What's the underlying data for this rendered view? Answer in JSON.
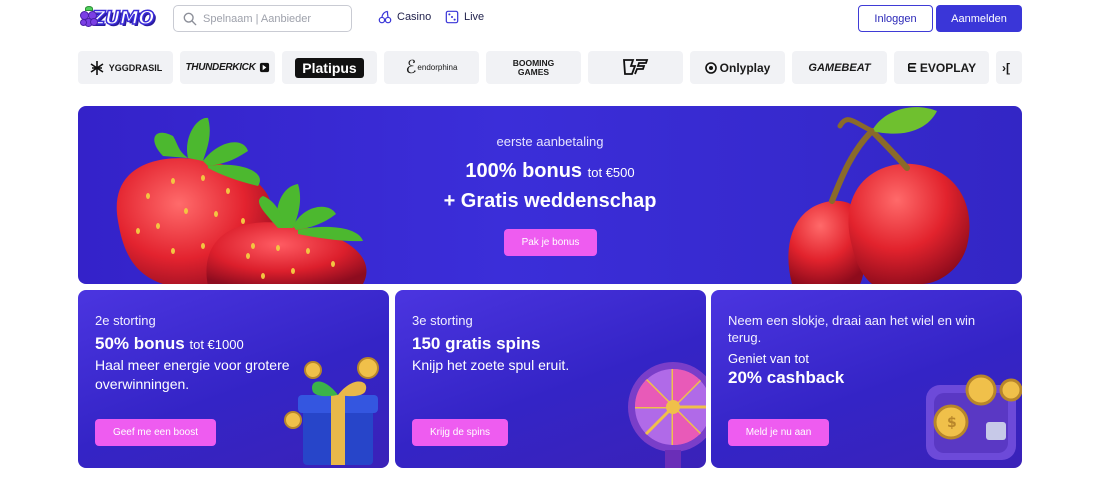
{
  "header": {
    "logo_text": "ZUMO",
    "search_placeholder": "Spelnaam | Aanbieder",
    "nav": [
      {
        "label": "Casino",
        "icon": "cherries-icon"
      },
      {
        "label": "Live",
        "icon": "dice-icon"
      }
    ],
    "login_label": "Inloggen",
    "signup_label": "Aanmelden"
  },
  "providers": [
    {
      "name": "YGGDRASIL"
    },
    {
      "name": "THUNDERKICK"
    },
    {
      "name": "Platipus"
    },
    {
      "name": "endorphina"
    },
    {
      "name": "BOOMING GAMES"
    },
    {
      "name": "BF GAMES"
    },
    {
      "name": "Onlyplay"
    },
    {
      "name": "GAMEBEAT"
    },
    {
      "name": "EVOPLAY"
    }
  ],
  "hero": {
    "small": "eerste aanbetaling",
    "big_main": "100% bonus",
    "big_suffix": "tot €500",
    "big2": "+ Gratis weddenschap",
    "button": "Pak je bonus"
  },
  "cards": [
    {
      "line1": "2e storting",
      "line2_main": "50% bonus",
      "line2_suffix": "tot €1000",
      "line3": "Haal meer energie voor grotere overwinningen.",
      "button": "Geef me een boost"
    },
    {
      "line1": "3e storting",
      "line2_main": "150 gratis spins",
      "line3": "Knijp het zoete spul eruit.",
      "button": "Krijg de spins"
    },
    {
      "line1": "Neem een slokje, draai aan het wiel en win terug.",
      "line1b": "Geniet van tot",
      "line2": "20% cashback",
      "button": "Meld je nu aan"
    }
  ],
  "colors": {
    "brand_blue": "#3a36d8",
    "accent_pink": "#ee5cf0",
    "hero_bg": "#3422c9"
  }
}
